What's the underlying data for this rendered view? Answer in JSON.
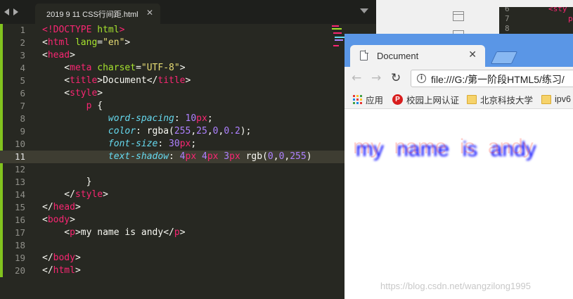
{
  "editor": {
    "tab_label": "2019 9 11 CSS行间距.html",
    "close_glyph": "✕",
    "current_line": 11,
    "lines": [
      {
        "num": "1",
        "tokens": [
          [
            "t",
            "<!DOCTYPE "
          ],
          [
            "a",
            "html"
          ],
          [
            "t",
            ">"
          ]
        ]
      },
      {
        "num": "2",
        "tokens": [
          [
            "p",
            "<"
          ],
          [
            "t",
            "html "
          ],
          [
            "a",
            "lang"
          ],
          [
            "p",
            "="
          ],
          [
            "s",
            "\"en\""
          ],
          [
            "p",
            ">"
          ]
        ]
      },
      {
        "num": "3",
        "tokens": [
          [
            "p",
            "<"
          ],
          [
            "t",
            "head"
          ],
          [
            "p",
            ">"
          ]
        ]
      },
      {
        "num": "4",
        "tokens": [
          [
            "p",
            "    <"
          ],
          [
            "t",
            "meta "
          ],
          [
            "a",
            "charset"
          ],
          [
            "p",
            "="
          ],
          [
            "s",
            "\"UTF-8\""
          ],
          [
            "p",
            ">"
          ]
        ]
      },
      {
        "num": "5",
        "tokens": [
          [
            "p",
            "    <"
          ],
          [
            "t",
            "title"
          ],
          [
            "p",
            ">Document</"
          ],
          [
            "t",
            "title"
          ],
          [
            "p",
            ">"
          ]
        ]
      },
      {
        "num": "6",
        "tokens": [
          [
            "p",
            "    <"
          ],
          [
            "t",
            "style"
          ],
          [
            "p",
            ">"
          ]
        ]
      },
      {
        "num": "7",
        "tokens": [
          [
            "p",
            "        "
          ],
          [
            "t",
            "p"
          ],
          [
            "p",
            " {"
          ]
        ]
      },
      {
        "num": "8",
        "tokens": [
          [
            "p",
            "            "
          ],
          [
            "k",
            "word-spacing"
          ],
          [
            "p",
            ": "
          ],
          [
            "n",
            "10"
          ],
          [
            "u",
            "px"
          ],
          [
            "p",
            ";"
          ]
        ]
      },
      {
        "num": "9",
        "tokens": [
          [
            "p",
            "            "
          ],
          [
            "k",
            "color"
          ],
          [
            "p",
            ": "
          ],
          [
            "p",
            "rgba("
          ],
          [
            "n",
            "255"
          ],
          [
            "p",
            ","
          ],
          [
            "n",
            "25"
          ],
          [
            "p",
            ","
          ],
          [
            "n",
            "0"
          ],
          [
            "p",
            ","
          ],
          [
            "n",
            "0.2"
          ],
          [
            "p",
            ");"
          ]
        ]
      },
      {
        "num": "10",
        "tokens": [
          [
            "p",
            "            "
          ],
          [
            "k",
            "font-size"
          ],
          [
            "p",
            ": "
          ],
          [
            "n",
            "30"
          ],
          [
            "u",
            "px"
          ],
          [
            "p",
            ";"
          ]
        ]
      },
      {
        "num": "11",
        "tokens": [
          [
            "p",
            "            "
          ],
          [
            "k",
            "text-shadow"
          ],
          [
            "p",
            ": "
          ],
          [
            "n",
            "4"
          ],
          [
            "u",
            "px "
          ],
          [
            "n",
            "4"
          ],
          [
            "u",
            "px "
          ],
          [
            "n",
            "3"
          ],
          [
            "u",
            "px "
          ],
          [
            "p",
            "rgb("
          ],
          [
            "n",
            "0"
          ],
          [
            "p",
            ","
          ],
          [
            "n",
            "0"
          ],
          [
            "p",
            ","
          ],
          [
            "n",
            "255"
          ],
          [
            "p",
            ")"
          ]
        ]
      },
      {
        "num": "12",
        "tokens": []
      },
      {
        "num": "13",
        "tokens": [
          [
            "p",
            "        }"
          ]
        ]
      },
      {
        "num": "14",
        "tokens": [
          [
            "p",
            "    </"
          ],
          [
            "t",
            "style"
          ],
          [
            "p",
            ">"
          ]
        ]
      },
      {
        "num": "15",
        "tokens": [
          [
            "p",
            "</"
          ],
          [
            "t",
            "head"
          ],
          [
            "p",
            ">"
          ]
        ]
      },
      {
        "num": "16",
        "tokens": [
          [
            "p",
            "<"
          ],
          [
            "t",
            "body"
          ],
          [
            "p",
            ">"
          ]
        ]
      },
      {
        "num": "17",
        "tokens": [
          [
            "p",
            "    <"
          ],
          [
            "t",
            "p"
          ],
          [
            "p",
            ">my name is andy</"
          ],
          [
            "t",
            "p"
          ],
          [
            "p",
            ">"
          ]
        ]
      },
      {
        "num": "18",
        "tokens": []
      },
      {
        "num": "19",
        "tokens": [
          [
            "p",
            "</"
          ],
          [
            "t",
            "body"
          ],
          [
            "p",
            ">"
          ]
        ]
      },
      {
        "num": "20",
        "tokens": [
          [
            "p",
            "</"
          ],
          [
            "t",
            "html"
          ],
          [
            "p",
            ">"
          ]
        ]
      }
    ]
  },
  "background_editor": {
    "line_a": "6",
    "line_b": "7",
    "line_c": "8",
    "tag_a": "<sty",
    "tag_b": "p"
  },
  "browser": {
    "tab_title": "Document",
    "tab_close": "✕",
    "back_glyph": "←",
    "forward_glyph": "→",
    "reload_glyph": "↻",
    "info_glyph": "i",
    "url": "file:///G:/第一阶段HTML5/练习/",
    "bookmarks": [
      {
        "label": "应用",
        "icon": "apps-grid-icon"
      },
      {
        "label": "校园上网认证",
        "icon": "p-badge-icon"
      },
      {
        "label": "北京科技大学",
        "icon": "folder-icon"
      },
      {
        "label": "ipv6",
        "icon": "folder-icon"
      }
    ],
    "page_text": "my name is andy"
  },
  "colors": {
    "accent_gutter": "#82c31e",
    "chrome_frame": "#5a96e6",
    "p_text": "rgba(255,25,0,0.2)",
    "p_shadow": "rgb(0,0,255)"
  },
  "watermark": "https://blog.csdn.net/wangzilong1995"
}
